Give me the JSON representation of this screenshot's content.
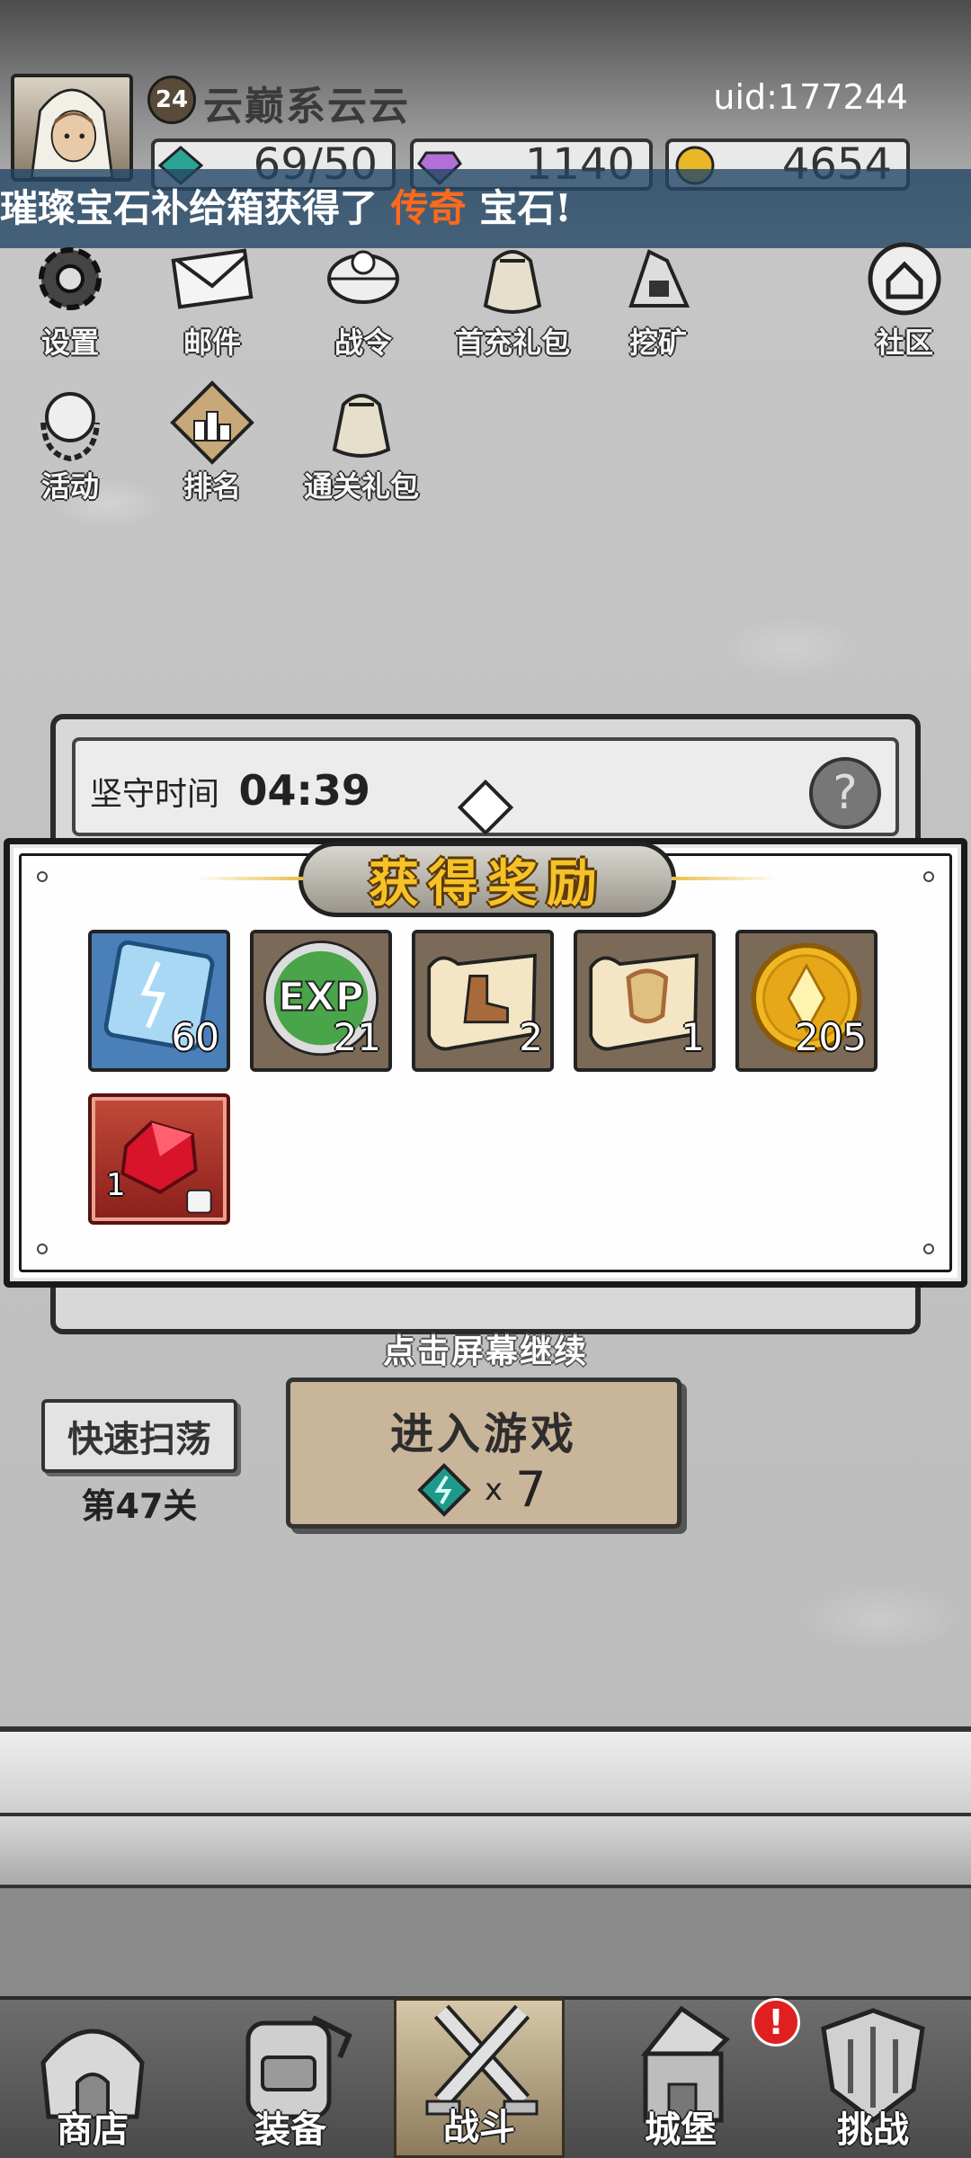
{
  "header": {
    "level": "24",
    "player_name": "云巅系云云",
    "uid": "uid:177244",
    "resources": {
      "energy": "69/50",
      "crystal": "1140",
      "gold": "4654"
    }
  },
  "ticker": {
    "prefix": "璀璨宝石补给箱获得了",
    "highlight": "传奇",
    "suffix": "宝石!"
  },
  "menu": [
    {
      "label": "设置",
      "icon": "gear-icon"
    },
    {
      "label": "邮件",
      "icon": "mail-icon"
    },
    {
      "label": "战令",
      "icon": "battle-pass-icon"
    },
    {
      "label": "首充礼包",
      "icon": "gift-bag-icon"
    },
    {
      "label": "挖矿",
      "icon": "mining-icon"
    },
    {
      "label": "社区",
      "icon": "home-icon"
    },
    {
      "label": "活动",
      "icon": "laurel-icon"
    },
    {
      "label": "排名",
      "icon": "podium-icon"
    },
    {
      "label": "通关礼包",
      "icon": "gift-bag-icon"
    }
  ],
  "defense": {
    "label": "坚守时间",
    "time": "04:39"
  },
  "reward_modal": {
    "title": "获得奖励",
    "items": [
      {
        "name": "energy-crystal",
        "count": "60"
      },
      {
        "name": "exp",
        "count": "21",
        "icon_text": "EXP"
      },
      {
        "name": "boots-scroll",
        "count": "2"
      },
      {
        "name": "armor-scroll",
        "count": "1"
      },
      {
        "name": "gold-coin",
        "count": "205"
      },
      {
        "name": "red-gem",
        "count": "1"
      }
    ]
  },
  "tap_continue": "点击屏幕继续",
  "actions": {
    "sweep_label": "快速扫荡",
    "stage_label": "第47关",
    "enter_label": "进入游戏",
    "cost_x": "x",
    "cost_amount": "7"
  },
  "bottom_nav": [
    {
      "label": "商店",
      "icon": "shop-icon"
    },
    {
      "label": "装备",
      "icon": "backpack-icon"
    },
    {
      "label": "战斗",
      "icon": "crossed-swords-icon",
      "active": true
    },
    {
      "label": "城堡",
      "icon": "castle-icon"
    },
    {
      "label": "挑战",
      "icon": "shield-icon"
    }
  ],
  "alert_badge": "!",
  "colors": {
    "ticker_highlight": "#ff6a1a",
    "title_gold": "#f6c227",
    "energy_teal": "#1f9a8a"
  }
}
